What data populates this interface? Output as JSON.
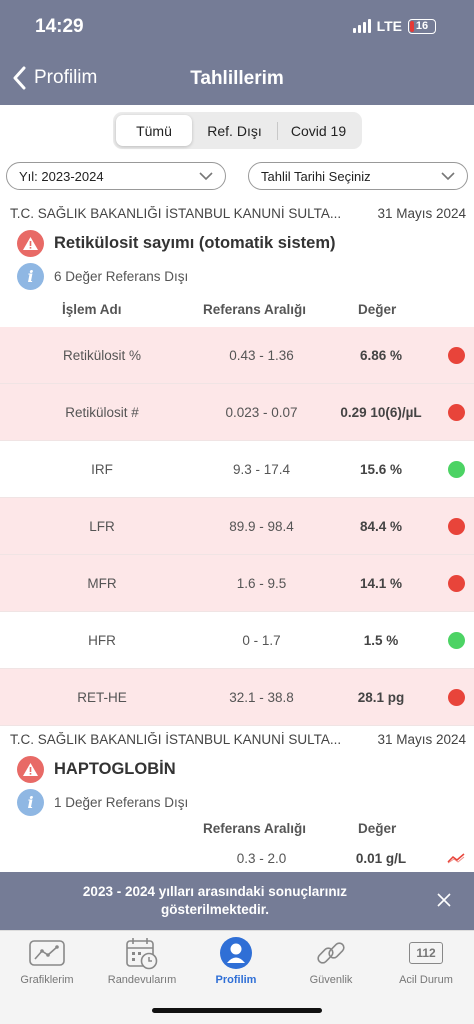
{
  "status": {
    "time": "14:29",
    "network": "LTE",
    "battery": "16"
  },
  "nav": {
    "back_label": "Profilim",
    "title": "Tahlillerim"
  },
  "segments": [
    "Tümü",
    "Ref. Dışı",
    "Covid 19"
  ],
  "filters": {
    "year": "Yıl: 2023-2024",
    "date": "Tahlil Tarihi Seçiniz"
  },
  "colors": {
    "header": "#757c96",
    "out_of_range_row": "#fde7e8",
    "red_dot": "#e8443a",
    "green_dot": "#4cd364",
    "active_tab": "#2f6fd6"
  },
  "results": [
    {
      "source": "T.C. SAĞLIK BAKANLIĞI İSTANBUL KANUNİ SULTA...",
      "date": "31 Mayıs 2024",
      "test_name": "Retikülosit sayımı (otomatik sistem)",
      "info": "6 Değer Referans Dışı",
      "columns": {
        "name": "İşlem Adı",
        "range": "Referans Aralığı",
        "value": "Değer"
      },
      "rows": [
        {
          "name": "Retikülosit %",
          "range": "0.43 - 1.36",
          "value": "6.86 %",
          "status": "out"
        },
        {
          "name": "Retikülosit #",
          "range": "0.023 - 0.07",
          "value": "0.29 10(6)/µL",
          "status": "out"
        },
        {
          "name": "IRF",
          "range": "9.3 - 17.4",
          "value": "15.6 %",
          "status": "in"
        },
        {
          "name": "LFR",
          "range": "89.9 - 98.4",
          "value": "84.4 %",
          "status": "out"
        },
        {
          "name": "MFR",
          "range": "1.6 - 9.5",
          "value": "14.1 %",
          "status": "out"
        },
        {
          "name": "HFR",
          "range": "0 - 1.7",
          "value": "1.5 %",
          "status": "in"
        },
        {
          "name": "RET-HE",
          "range": "32.1 - 38.8",
          "value": "28.1 pg",
          "status": "out"
        }
      ]
    },
    {
      "source": "T.C. SAĞLIK BAKANLIĞI İSTANBUL KANUNİ SULTA...",
      "date": "31 Mayıs 2024",
      "test_name": "HAPTOGLOBİN",
      "info": "1 Değer Referans Dışı",
      "columns": {
        "range": "Referans Aralığı",
        "value": "Değer"
      },
      "rows": [
        {
          "range": "0.3 - 2.0",
          "value": "0.01 g/L",
          "icon": "trend-chart-icon"
        }
      ]
    }
  ],
  "banner": {
    "text": "2023 - 2024 yılları arasındaki sonuçlarınız gösterilmektedir."
  },
  "tabs": [
    {
      "label": "Grafiklerim",
      "icon": "chart-icon"
    },
    {
      "label": "Randevularım",
      "icon": "calendar-clock-icon"
    },
    {
      "label": "Profilim",
      "icon": "profile-icon",
      "active": true
    },
    {
      "label": "Güvenlik",
      "icon": "link-icon"
    },
    {
      "label": "Acil Durum",
      "icon": "emergency-112-icon",
      "badge": "112"
    }
  ]
}
